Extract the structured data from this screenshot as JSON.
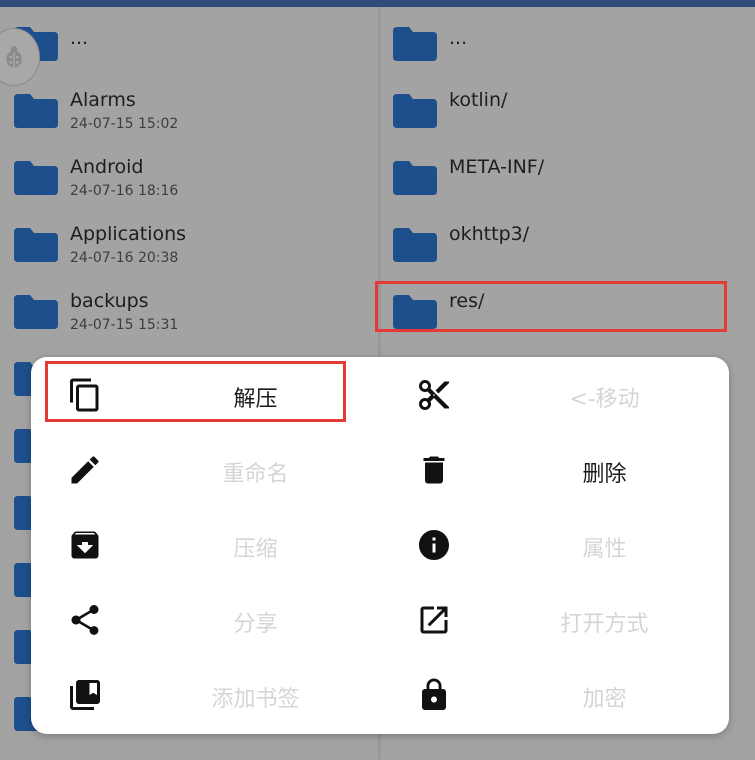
{
  "left_pane": {
    "items": [
      {
        "name": "...",
        "date": ""
      },
      {
        "name": "Alarms",
        "date": "24-07-15 15:02"
      },
      {
        "name": "Android",
        "date": "24-07-16 18:16"
      },
      {
        "name": "Applications",
        "date": "24-07-16 20:38"
      },
      {
        "name": "backups",
        "date": "24-07-15 15:31"
      }
    ]
  },
  "right_pane": {
    "items": [
      {
        "name": "..."
      },
      {
        "name": "kotlin/"
      },
      {
        "name": "META-INF/"
      },
      {
        "name": "okhttp3/"
      },
      {
        "name": "res/"
      }
    ]
  },
  "context_menu": {
    "items": [
      {
        "label": "解压",
        "icon": "copy-icon",
        "enabled": true
      },
      {
        "label": "<-移动",
        "icon": "scissors-icon",
        "enabled": false
      },
      {
        "label": "重命名",
        "icon": "pencil-icon",
        "enabled": false
      },
      {
        "label": "删除",
        "icon": "trash-icon",
        "enabled": true
      },
      {
        "label": "压缩",
        "icon": "archive-icon",
        "enabled": false
      },
      {
        "label": "属性",
        "icon": "info-icon",
        "enabled": false
      },
      {
        "label": "分享",
        "icon": "share-icon",
        "enabled": false
      },
      {
        "label": "打开方式",
        "icon": "open-external-icon",
        "enabled": false
      },
      {
        "label": "添加书签",
        "icon": "bookmark-icon",
        "enabled": false
      },
      {
        "label": "加密",
        "icon": "lock-icon",
        "enabled": false
      }
    ]
  },
  "colors": {
    "folder": "#1d4f8c",
    "highlight": "#e53935",
    "sheet_bg": "#ffffff",
    "disabled_text": "#d5d5d5"
  }
}
